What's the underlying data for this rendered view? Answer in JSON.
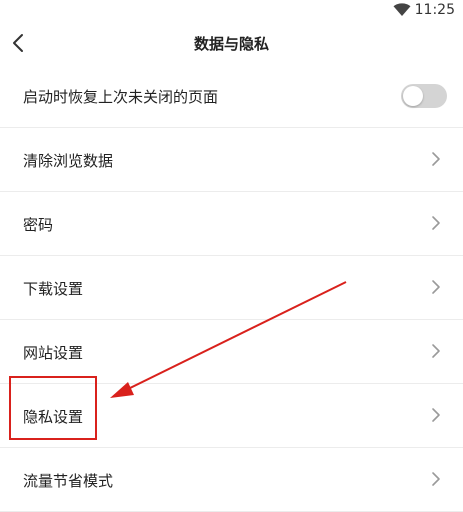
{
  "status_bar": {
    "time": "11:25",
    "wifi_icon": "wifi-icon"
  },
  "header": {
    "back_icon": "chevron-left-icon",
    "title": "数据与隐私"
  },
  "settings": {
    "items": [
      {
        "label": "启动时恢复上次未关闭的页面",
        "control": "toggle",
        "toggle_on": false
      },
      {
        "label": "清除浏览数据",
        "control": "chevron"
      },
      {
        "label": "密码",
        "control": "chevron"
      },
      {
        "label": "下载设置",
        "control": "chevron"
      },
      {
        "label": "网站设置",
        "control": "chevron"
      },
      {
        "label": "隐私设置",
        "control": "chevron",
        "highlighted": true
      },
      {
        "label": "流量节省模式",
        "control": "chevron"
      }
    ]
  },
  "colors": {
    "annotation": "#d9211c",
    "toggle_off": "#d4d4d4",
    "divider": "#ececec",
    "chevron": "#9a9a9a"
  }
}
